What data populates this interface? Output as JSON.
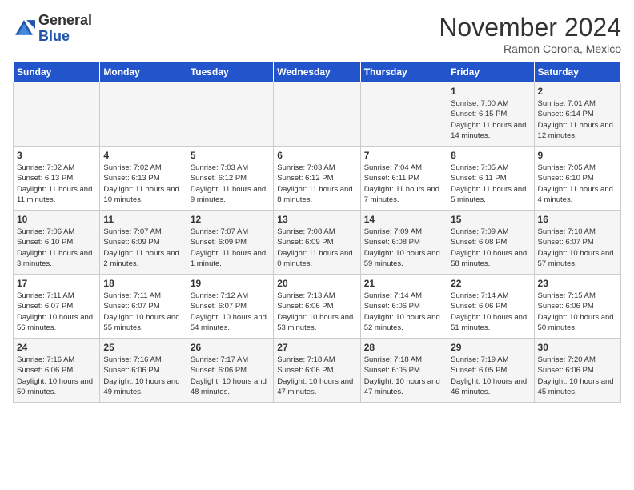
{
  "header": {
    "logo_general": "General",
    "logo_blue": "Blue",
    "month_title": "November 2024",
    "location": "Ramon Corona, Mexico"
  },
  "weekdays": [
    "Sunday",
    "Monday",
    "Tuesday",
    "Wednesday",
    "Thursday",
    "Friday",
    "Saturday"
  ],
  "weeks": [
    [
      {
        "day": "",
        "info": ""
      },
      {
        "day": "",
        "info": ""
      },
      {
        "day": "",
        "info": ""
      },
      {
        "day": "",
        "info": ""
      },
      {
        "day": "",
        "info": ""
      },
      {
        "day": "1",
        "info": "Sunrise: 7:00 AM\nSunset: 6:15 PM\nDaylight: 11 hours and 14 minutes."
      },
      {
        "day": "2",
        "info": "Sunrise: 7:01 AM\nSunset: 6:14 PM\nDaylight: 11 hours and 12 minutes."
      }
    ],
    [
      {
        "day": "3",
        "info": "Sunrise: 7:02 AM\nSunset: 6:13 PM\nDaylight: 11 hours and 11 minutes."
      },
      {
        "day": "4",
        "info": "Sunrise: 7:02 AM\nSunset: 6:13 PM\nDaylight: 11 hours and 10 minutes."
      },
      {
        "day": "5",
        "info": "Sunrise: 7:03 AM\nSunset: 6:12 PM\nDaylight: 11 hours and 9 minutes."
      },
      {
        "day": "6",
        "info": "Sunrise: 7:03 AM\nSunset: 6:12 PM\nDaylight: 11 hours and 8 minutes."
      },
      {
        "day": "7",
        "info": "Sunrise: 7:04 AM\nSunset: 6:11 PM\nDaylight: 11 hours and 7 minutes."
      },
      {
        "day": "8",
        "info": "Sunrise: 7:05 AM\nSunset: 6:11 PM\nDaylight: 11 hours and 5 minutes."
      },
      {
        "day": "9",
        "info": "Sunrise: 7:05 AM\nSunset: 6:10 PM\nDaylight: 11 hours and 4 minutes."
      }
    ],
    [
      {
        "day": "10",
        "info": "Sunrise: 7:06 AM\nSunset: 6:10 PM\nDaylight: 11 hours and 3 minutes."
      },
      {
        "day": "11",
        "info": "Sunrise: 7:07 AM\nSunset: 6:09 PM\nDaylight: 11 hours and 2 minutes."
      },
      {
        "day": "12",
        "info": "Sunrise: 7:07 AM\nSunset: 6:09 PM\nDaylight: 11 hours and 1 minute."
      },
      {
        "day": "13",
        "info": "Sunrise: 7:08 AM\nSunset: 6:09 PM\nDaylight: 11 hours and 0 minutes."
      },
      {
        "day": "14",
        "info": "Sunrise: 7:09 AM\nSunset: 6:08 PM\nDaylight: 10 hours and 59 minutes."
      },
      {
        "day": "15",
        "info": "Sunrise: 7:09 AM\nSunset: 6:08 PM\nDaylight: 10 hours and 58 minutes."
      },
      {
        "day": "16",
        "info": "Sunrise: 7:10 AM\nSunset: 6:07 PM\nDaylight: 10 hours and 57 minutes."
      }
    ],
    [
      {
        "day": "17",
        "info": "Sunrise: 7:11 AM\nSunset: 6:07 PM\nDaylight: 10 hours and 56 minutes."
      },
      {
        "day": "18",
        "info": "Sunrise: 7:11 AM\nSunset: 6:07 PM\nDaylight: 10 hours and 55 minutes."
      },
      {
        "day": "19",
        "info": "Sunrise: 7:12 AM\nSunset: 6:07 PM\nDaylight: 10 hours and 54 minutes."
      },
      {
        "day": "20",
        "info": "Sunrise: 7:13 AM\nSunset: 6:06 PM\nDaylight: 10 hours and 53 minutes."
      },
      {
        "day": "21",
        "info": "Sunrise: 7:14 AM\nSunset: 6:06 PM\nDaylight: 10 hours and 52 minutes."
      },
      {
        "day": "22",
        "info": "Sunrise: 7:14 AM\nSunset: 6:06 PM\nDaylight: 10 hours and 51 minutes."
      },
      {
        "day": "23",
        "info": "Sunrise: 7:15 AM\nSunset: 6:06 PM\nDaylight: 10 hours and 50 minutes."
      }
    ],
    [
      {
        "day": "24",
        "info": "Sunrise: 7:16 AM\nSunset: 6:06 PM\nDaylight: 10 hours and 50 minutes."
      },
      {
        "day": "25",
        "info": "Sunrise: 7:16 AM\nSunset: 6:06 PM\nDaylight: 10 hours and 49 minutes."
      },
      {
        "day": "26",
        "info": "Sunrise: 7:17 AM\nSunset: 6:06 PM\nDaylight: 10 hours and 48 minutes."
      },
      {
        "day": "27",
        "info": "Sunrise: 7:18 AM\nSunset: 6:06 PM\nDaylight: 10 hours and 47 minutes."
      },
      {
        "day": "28",
        "info": "Sunrise: 7:18 AM\nSunset: 6:05 PM\nDaylight: 10 hours and 47 minutes."
      },
      {
        "day": "29",
        "info": "Sunrise: 7:19 AM\nSunset: 6:05 PM\nDaylight: 10 hours and 46 minutes."
      },
      {
        "day": "30",
        "info": "Sunrise: 7:20 AM\nSunset: 6:06 PM\nDaylight: 10 hours and 45 minutes."
      }
    ]
  ]
}
